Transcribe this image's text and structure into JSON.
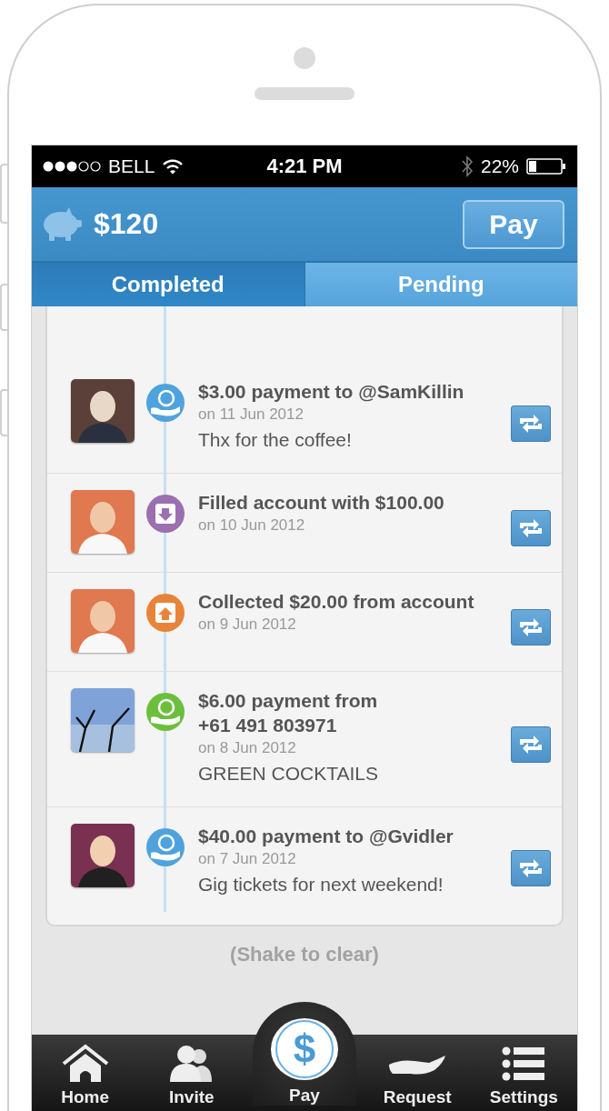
{
  "status_bar": {
    "carrier": "BELL",
    "time": "4:21 PM",
    "battery": "22%"
  },
  "header": {
    "balance": "$120",
    "pay_button": "Pay"
  },
  "tabs": [
    {
      "label": "Completed",
      "selected": true
    },
    {
      "label": "Pending",
      "selected": false
    }
  ],
  "transactions": [
    {
      "kind": "payment",
      "color": "#4fa3dc",
      "title": "$3.00 payment to @SamKillin",
      "date": "on 11 Jun 2012",
      "note": "Thx for the coffee!"
    },
    {
      "kind": "fill",
      "color": "#9b6fb0",
      "title": "Filled account with $100.00",
      "date": "on 10 Jun 2012"
    },
    {
      "kind": "collect",
      "color": "#e8843a",
      "title": "Collected $20.00 from account",
      "date": "on 9 Jun 2012"
    },
    {
      "kind": "payment",
      "color": "#6cbf3c",
      "title": "$6.00 payment from\n+61 491 803971",
      "date": "on 8 Jun 2012",
      "note": "GREEN COCKTAILS"
    },
    {
      "kind": "payment",
      "color": "#4fa3dc",
      "title": "$40.00 payment to @Gvidler",
      "date": "on 7 Jun 2012",
      "note": "Gig tickets for next weekend!"
    }
  ],
  "hint": "(Shake to clear)",
  "nav": [
    {
      "label": "Home",
      "kind": "home"
    },
    {
      "label": "Invite",
      "kind": "invite"
    },
    {
      "label": "Pay",
      "kind": "pay",
      "symbol": "$"
    },
    {
      "label": "Request",
      "kind": "request"
    },
    {
      "label": "Settings",
      "kind": "settings"
    }
  ]
}
